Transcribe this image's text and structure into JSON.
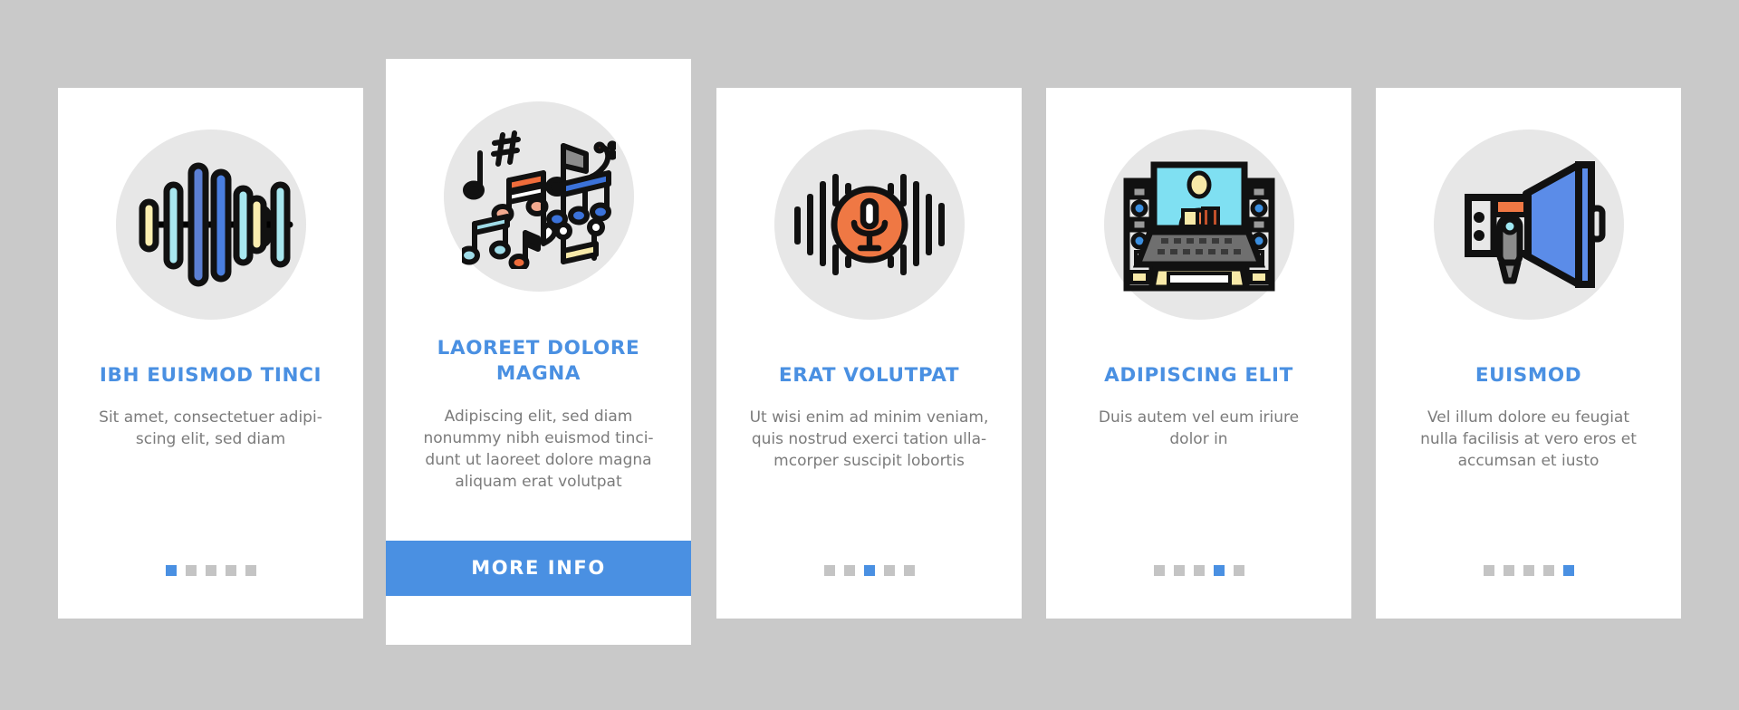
{
  "background_color": "#c9c9c9",
  "theme": {
    "accent": "#4a90e2",
    "card_bg": "#ffffff",
    "icon_circle": "#e7e7e7",
    "title_color": "#4a90e2",
    "body_color": "#7b7b7b",
    "dot_inactive": "#c4c4c4",
    "dot_active": "#4a90e2"
  },
  "cards": [
    {
      "id": "card-1",
      "icon_name": "sound-waveform-icon",
      "title": "IBH EUISMOD TINCI",
      "body": "Sit amet, consectetuer adipi-\nscing elit, sed diam",
      "dots": {
        "count": 5,
        "active_index": 0
      },
      "featured": false
    },
    {
      "id": "card-2",
      "icon_name": "music-notes-icon",
      "title": "LAOREET DOLORE\nMAGNA",
      "body": "Adipiscing elit, sed diam\nnonummy nibh euismod tinci-\ndunt ut laoreet dolore magna\naliquam erat volutpat",
      "button_label": "MORE INFO",
      "featured": true
    },
    {
      "id": "card-3",
      "icon_name": "microphone-waveform-icon",
      "title": "ERAT VOLUTPAT",
      "body": "Ut wisi enim ad minim veniam,\nquis nostrud exerci tation ulla-\nmcorper suscipit lobortis",
      "dots": {
        "count": 5,
        "active_index": 2
      },
      "featured": false
    },
    {
      "id": "card-4",
      "icon_name": "recording-studio-workstation-icon",
      "title": "ADIPISCING ELIT",
      "body": "Duis autem vel eum iriure\ndolor in",
      "dots": {
        "count": 5,
        "active_index": 3
      },
      "featured": false
    },
    {
      "id": "card-5",
      "icon_name": "megaphone-icon",
      "title": "EUISMOD",
      "body": "Vel illum dolore eu feugiat\nnulla facilisis at vero eros et\naccumsan et iusto",
      "dots": {
        "count": 5,
        "active_index": 4
      },
      "featured": false
    }
  ]
}
